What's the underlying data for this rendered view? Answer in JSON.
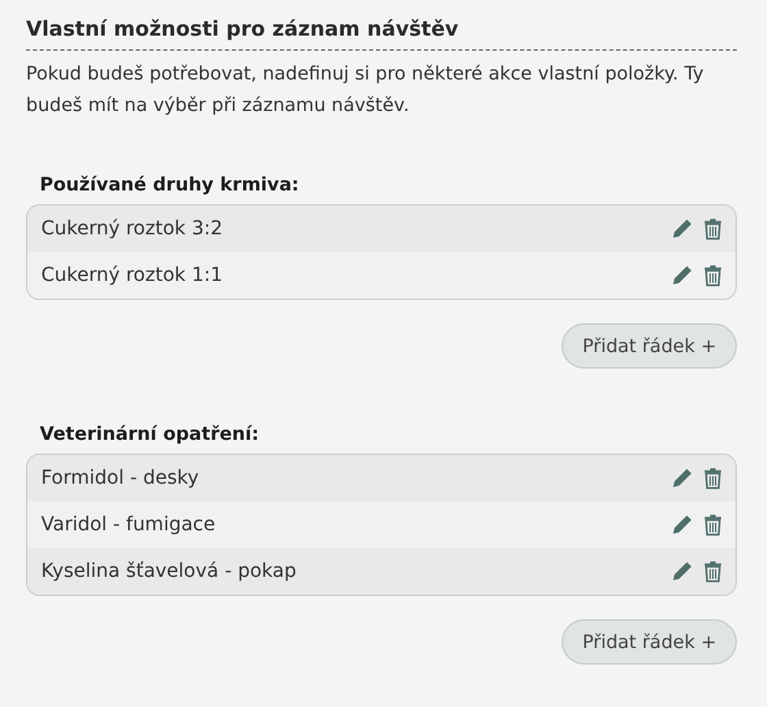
{
  "title": "Vlastní možnosti pro záznam návštěv",
  "description": "Pokud budeš potřebovat, nadefinuj si pro některé akce vlastní položky. Ty budeš mít na výběr při záznamu návštěv.",
  "sections": [
    {
      "heading": "Používané druhy krmiva:",
      "rows": [
        "Cukerný roztok 3:2",
        "Cukerný roztok 1:1"
      ],
      "add_button": "Přidat řádek +"
    },
    {
      "heading": "Veterinární opatření:",
      "rows": [
        "Formidol - desky",
        "Varidol - fumigace",
        "Kyselina šťavelová - pokap"
      ],
      "add_button": "Přidat řádek +"
    }
  ]
}
